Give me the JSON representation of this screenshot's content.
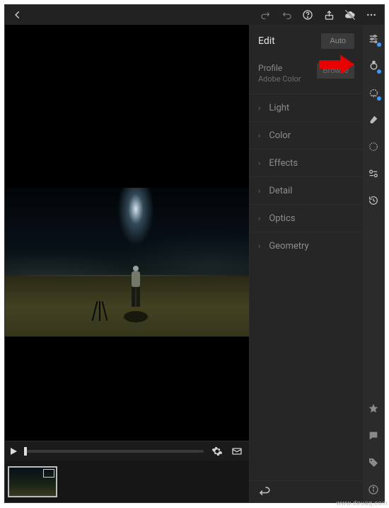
{
  "edit": {
    "title": "Edit",
    "auto_label": "Auto",
    "profile_label": "Profile",
    "profile_value": "Adobe Color",
    "browse_label": "Browse",
    "sections": [
      "Light",
      "Color",
      "Effects",
      "Detail",
      "Optics",
      "Geometry"
    ]
  },
  "topbar_icons": [
    "back",
    "redo",
    "undo",
    "help",
    "share",
    "cloud-off",
    "more"
  ],
  "rail_icons": [
    "sliders",
    "healing",
    "mask",
    "brush",
    "radial",
    "adjust",
    "history"
  ],
  "rail_footer_icons": [
    "star",
    "comment",
    "tag",
    "info"
  ],
  "filmstrip_icons": [
    "play",
    "settings",
    "export"
  ],
  "watermark": "www.deuaq.com"
}
